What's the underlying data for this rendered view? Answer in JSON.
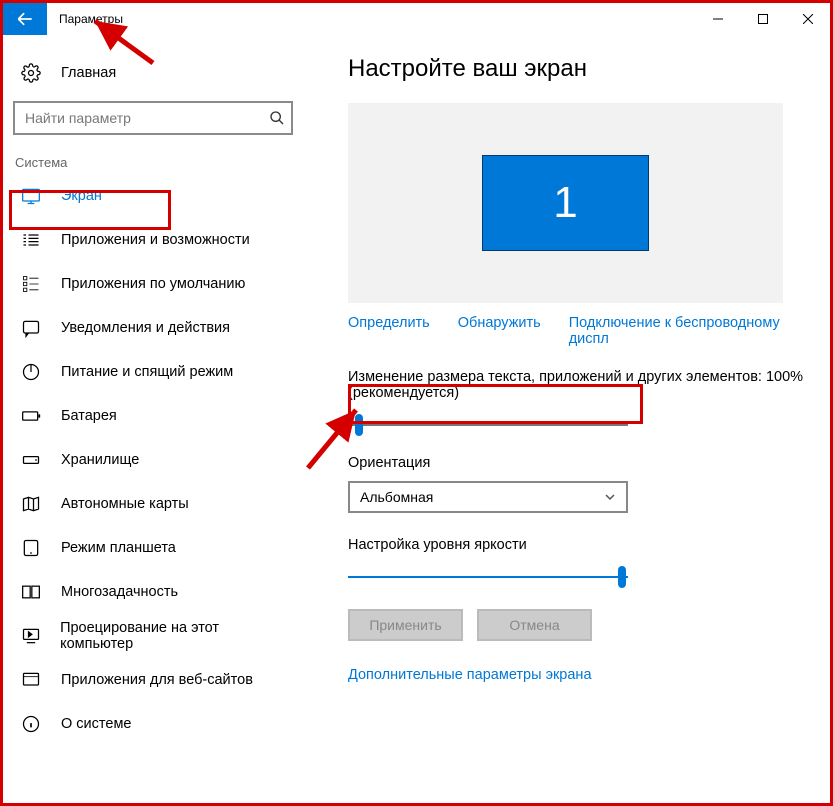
{
  "titlebar": {
    "title": "Параметры"
  },
  "sidebar": {
    "home": "Главная",
    "search_placeholder": "Найти параметр",
    "group": "Система",
    "items": [
      "Экран",
      "Приложения и возможности",
      "Приложения по умолчанию",
      "Уведомления и действия",
      "Питание и спящий режим",
      "Батарея",
      "Хранилище",
      "Автономные карты",
      "Режим планшета",
      "Многозадачность",
      "Проецирование на этот компьютер",
      "Приложения для веб-сайтов",
      "О системе"
    ]
  },
  "main": {
    "heading": "Настройте ваш экран",
    "monitor_number": "1",
    "links": {
      "detect": "Определить",
      "identify": "Обнаружить",
      "wireless": "Подключение к беспроводному диспл"
    },
    "scale_label": "Изменение размера текста, приложений и других элементов: 100% (рекомендуется)",
    "orientation_label": "Ориентация",
    "orientation_value": "Альбомная",
    "brightness_label": "Настройка уровня яркости",
    "brightness_percent": 100,
    "apply": "Применить",
    "cancel": "Отмена",
    "advanced": "Дополнительные параметры экрана"
  }
}
